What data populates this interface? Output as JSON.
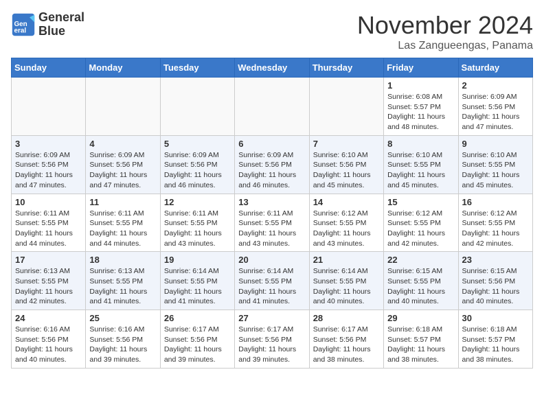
{
  "header": {
    "logo_line1": "General",
    "logo_line2": "Blue",
    "month": "November 2024",
    "location": "Las Zangueengas, Panama"
  },
  "weekdays": [
    "Sunday",
    "Monday",
    "Tuesday",
    "Wednesday",
    "Thursday",
    "Friday",
    "Saturday"
  ],
  "weeks": [
    [
      {
        "day": "",
        "info": ""
      },
      {
        "day": "",
        "info": ""
      },
      {
        "day": "",
        "info": ""
      },
      {
        "day": "",
        "info": ""
      },
      {
        "day": "",
        "info": ""
      },
      {
        "day": "1",
        "info": "Sunrise: 6:08 AM\nSunset: 5:57 PM\nDaylight: 11 hours\nand 48 minutes."
      },
      {
        "day": "2",
        "info": "Sunrise: 6:09 AM\nSunset: 5:56 PM\nDaylight: 11 hours\nand 47 minutes."
      }
    ],
    [
      {
        "day": "3",
        "info": "Sunrise: 6:09 AM\nSunset: 5:56 PM\nDaylight: 11 hours\nand 47 minutes."
      },
      {
        "day": "4",
        "info": "Sunrise: 6:09 AM\nSunset: 5:56 PM\nDaylight: 11 hours\nand 47 minutes."
      },
      {
        "day": "5",
        "info": "Sunrise: 6:09 AM\nSunset: 5:56 PM\nDaylight: 11 hours\nand 46 minutes."
      },
      {
        "day": "6",
        "info": "Sunrise: 6:09 AM\nSunset: 5:56 PM\nDaylight: 11 hours\nand 46 minutes."
      },
      {
        "day": "7",
        "info": "Sunrise: 6:10 AM\nSunset: 5:56 PM\nDaylight: 11 hours\nand 45 minutes."
      },
      {
        "day": "8",
        "info": "Sunrise: 6:10 AM\nSunset: 5:55 PM\nDaylight: 11 hours\nand 45 minutes."
      },
      {
        "day": "9",
        "info": "Sunrise: 6:10 AM\nSunset: 5:55 PM\nDaylight: 11 hours\nand 45 minutes."
      }
    ],
    [
      {
        "day": "10",
        "info": "Sunrise: 6:11 AM\nSunset: 5:55 PM\nDaylight: 11 hours\nand 44 minutes."
      },
      {
        "day": "11",
        "info": "Sunrise: 6:11 AM\nSunset: 5:55 PM\nDaylight: 11 hours\nand 44 minutes."
      },
      {
        "day": "12",
        "info": "Sunrise: 6:11 AM\nSunset: 5:55 PM\nDaylight: 11 hours\nand 43 minutes."
      },
      {
        "day": "13",
        "info": "Sunrise: 6:11 AM\nSunset: 5:55 PM\nDaylight: 11 hours\nand 43 minutes."
      },
      {
        "day": "14",
        "info": "Sunrise: 6:12 AM\nSunset: 5:55 PM\nDaylight: 11 hours\nand 43 minutes."
      },
      {
        "day": "15",
        "info": "Sunrise: 6:12 AM\nSunset: 5:55 PM\nDaylight: 11 hours\nand 42 minutes."
      },
      {
        "day": "16",
        "info": "Sunrise: 6:12 AM\nSunset: 5:55 PM\nDaylight: 11 hours\nand 42 minutes."
      }
    ],
    [
      {
        "day": "17",
        "info": "Sunrise: 6:13 AM\nSunset: 5:55 PM\nDaylight: 11 hours\nand 42 minutes."
      },
      {
        "day": "18",
        "info": "Sunrise: 6:13 AM\nSunset: 5:55 PM\nDaylight: 11 hours\nand 41 minutes."
      },
      {
        "day": "19",
        "info": "Sunrise: 6:14 AM\nSunset: 5:55 PM\nDaylight: 11 hours\nand 41 minutes."
      },
      {
        "day": "20",
        "info": "Sunrise: 6:14 AM\nSunset: 5:55 PM\nDaylight: 11 hours\nand 41 minutes."
      },
      {
        "day": "21",
        "info": "Sunrise: 6:14 AM\nSunset: 5:55 PM\nDaylight: 11 hours\nand 40 minutes."
      },
      {
        "day": "22",
        "info": "Sunrise: 6:15 AM\nSunset: 5:55 PM\nDaylight: 11 hours\nand 40 minutes."
      },
      {
        "day": "23",
        "info": "Sunrise: 6:15 AM\nSunset: 5:56 PM\nDaylight: 11 hours\nand 40 minutes."
      }
    ],
    [
      {
        "day": "24",
        "info": "Sunrise: 6:16 AM\nSunset: 5:56 PM\nDaylight: 11 hours\nand 40 minutes."
      },
      {
        "day": "25",
        "info": "Sunrise: 6:16 AM\nSunset: 5:56 PM\nDaylight: 11 hours\nand 39 minutes."
      },
      {
        "day": "26",
        "info": "Sunrise: 6:17 AM\nSunset: 5:56 PM\nDaylight: 11 hours\nand 39 minutes."
      },
      {
        "day": "27",
        "info": "Sunrise: 6:17 AM\nSunset: 5:56 PM\nDaylight: 11 hours\nand 39 minutes."
      },
      {
        "day": "28",
        "info": "Sunrise: 6:17 AM\nSunset: 5:56 PM\nDaylight: 11 hours\nand 38 minutes."
      },
      {
        "day": "29",
        "info": "Sunrise: 6:18 AM\nSunset: 5:57 PM\nDaylight: 11 hours\nand 38 minutes."
      },
      {
        "day": "30",
        "info": "Sunrise: 6:18 AM\nSunset: 5:57 PM\nDaylight: 11 hours\nand 38 minutes."
      }
    ]
  ]
}
